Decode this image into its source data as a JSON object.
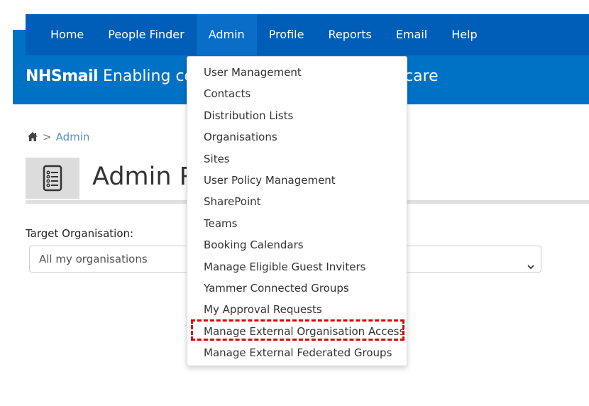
{
  "nav": {
    "items": [
      {
        "label": "Home"
      },
      {
        "label": "People Finder"
      },
      {
        "label": "Admin"
      },
      {
        "label": "Profile"
      },
      {
        "label": "Reports"
      },
      {
        "label": "Email"
      },
      {
        "label": "Help"
      }
    ],
    "active": "Admin"
  },
  "banner": {
    "brand": "NHSmail",
    "tagline": "Enabling colla",
    "tagline_end": "care"
  },
  "breadcrumb": {
    "icon": "home-icon",
    "separator": ">",
    "current": "Admin"
  },
  "header": {
    "icon": "list-document-icon",
    "title": "Admin Re"
  },
  "form": {
    "label": "Target Organisation:",
    "select_value": "All my organisations"
  },
  "admin_menu": {
    "items": [
      {
        "label": "User Management"
      },
      {
        "label": "Contacts"
      },
      {
        "label": "Distribution Lists"
      },
      {
        "label": "Organisations"
      },
      {
        "label": "Sites"
      },
      {
        "label": "User Policy Management"
      },
      {
        "label": "SharePoint"
      },
      {
        "label": "Teams"
      },
      {
        "label": "Booking Calendars"
      },
      {
        "label": "Manage Eligible Guest Inviters"
      },
      {
        "label": "Yammer Connected Groups"
      },
      {
        "label": "My Approval Requests"
      },
      {
        "label": "Manage External Organisation Access"
      },
      {
        "label": "Manage External Federated Groups"
      }
    ],
    "highlighted": "Manage External Organisation Access"
  },
  "colors": {
    "nav_bg": "#005eb8",
    "banner_bg": "#0072c6",
    "highlight": "#e00000"
  }
}
